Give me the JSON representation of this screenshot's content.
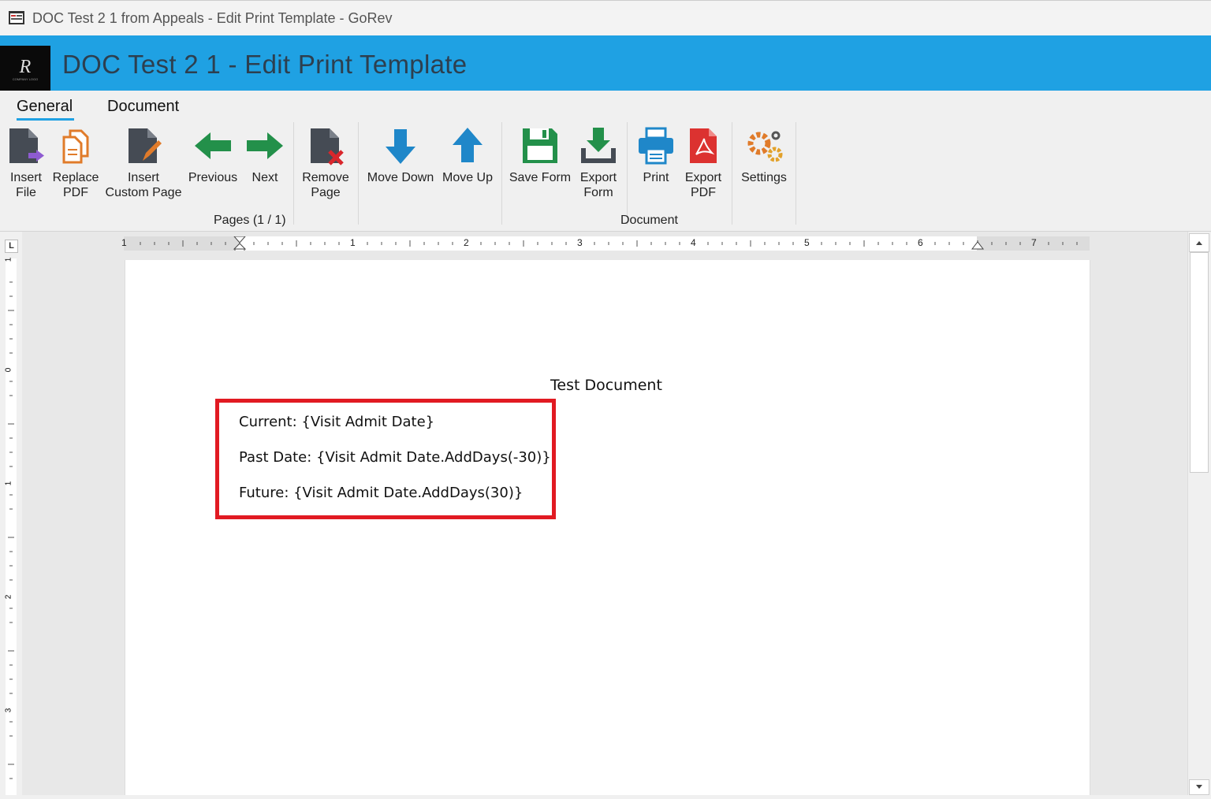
{
  "window": {
    "title": "DOC Test 2 1 from Appeals - Edit Print Template - GoRev"
  },
  "header": {
    "title": "DOC Test 2 1 - Edit Print Template",
    "accent_color": "#1fa1e3",
    "logo_text": "COMPANY LOGO"
  },
  "tabs": [
    {
      "label": "General",
      "active": true
    },
    {
      "label": "Document",
      "active": false
    }
  ],
  "toolbar": {
    "insert_file": "Insert\nFile",
    "replace_pdf": "Replace\nPDF",
    "insert_custom_page": "Insert\nCustom Page",
    "previous": "Previous",
    "next": "Next",
    "remove_page": "Remove\nPage",
    "move_down": "Move Down",
    "move_up": "Move Up",
    "save_form": "Save Form",
    "export_form": "Export\nForm",
    "print": "Print",
    "export_pdf": "Export\nPDF",
    "settings": "Settings"
  },
  "groups": {
    "pages": "Pages (1 / 1)",
    "document": "Document"
  },
  "ruler": {
    "h_labels": [
      "1",
      "1",
      "2",
      "3",
      "4",
      "5",
      "6",
      "7"
    ],
    "v_labels": [
      "1",
      "0",
      "1",
      "2",
      "3"
    ],
    "corner": "L"
  },
  "document": {
    "heading": "Test Document",
    "lines": [
      "Current: {Visit Admit Date}",
      "Past Date: {Visit Admit Date.AddDays(-30)}",
      "Future: {Visit Admit Date.AddDays(30)}"
    ],
    "highlight_color": "#e11a22"
  }
}
